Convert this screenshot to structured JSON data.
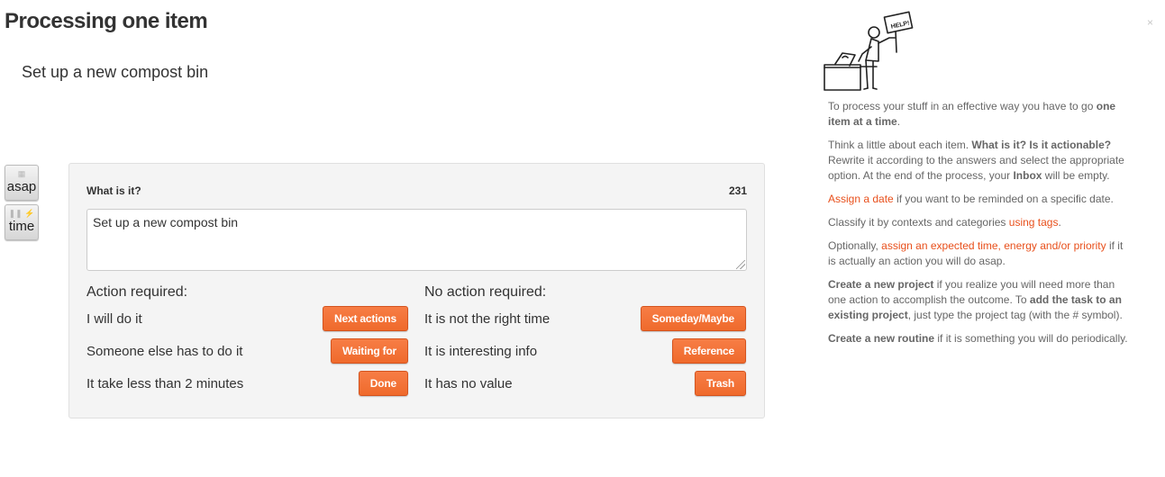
{
  "page": {
    "title": "Processing one item"
  },
  "item": {
    "title": "Set up a new compost bin"
  },
  "side_buttons": {
    "asap": {
      "label": "asap",
      "icon": "calendar-icon"
    },
    "time": {
      "label": "time",
      "icon": "pause-energy-icon"
    }
  },
  "form": {
    "what_label": "What is it?",
    "char_count": "231",
    "value": "Set up a new compost bin"
  },
  "action_required": {
    "title": "Action required:",
    "rows": [
      {
        "text": "I will do it",
        "button": "Next actions"
      },
      {
        "text": "Someone else has to do it",
        "button": "Waiting for"
      },
      {
        "text": "It take less than 2 minutes",
        "button": "Done"
      }
    ]
  },
  "no_action_required": {
    "title": "No action required:",
    "rows": [
      {
        "text": "It is not the right time",
        "button": "Someday/Maybe"
      },
      {
        "text": "It is interesting info",
        "button": "Reference"
      },
      {
        "text": "It has no value",
        "button": "Trash"
      }
    ]
  },
  "help": {
    "sign_text": "HELP!",
    "close": "×",
    "p1_a": "To process your stuff in an effective way you have to go ",
    "p1_b": "one item at a time",
    "p1_c": ".",
    "p2_a": "Think a little about each item. ",
    "p2_b": "What is it? Is it actionable?",
    "p2_c": " Rewrite it according to the answers and select the appropriate option. At the end of the process, your ",
    "p2_d": "Inbox",
    "p2_e": " will be empty.",
    "p3_link": "Assign a date",
    "p3_rest": " if you want to be reminded on a specific date.",
    "p4_a": "Classify it by contexts and categories ",
    "p4_link": "using tags",
    "p4_c": ".",
    "p5_a": "Optionally, ",
    "p5_link": "assign an expected time, energy and/or priority",
    "p5_c": " if it is actually an action you will do asap.",
    "p6_a": "Create a new project",
    "p6_b": " if you realize you will need more than one action to accomplish the outcome. To ",
    "p6_c": "add the task to an existing project",
    "p6_d": ", just type the project tag (with the # symbol).",
    "p7_a": "Create a new routine",
    "p7_b": " if it is something you will do periodically."
  },
  "colors": {
    "accent": "#ef6a2c",
    "link": "#e8501c",
    "panel_bg": "#f4f4f4"
  }
}
